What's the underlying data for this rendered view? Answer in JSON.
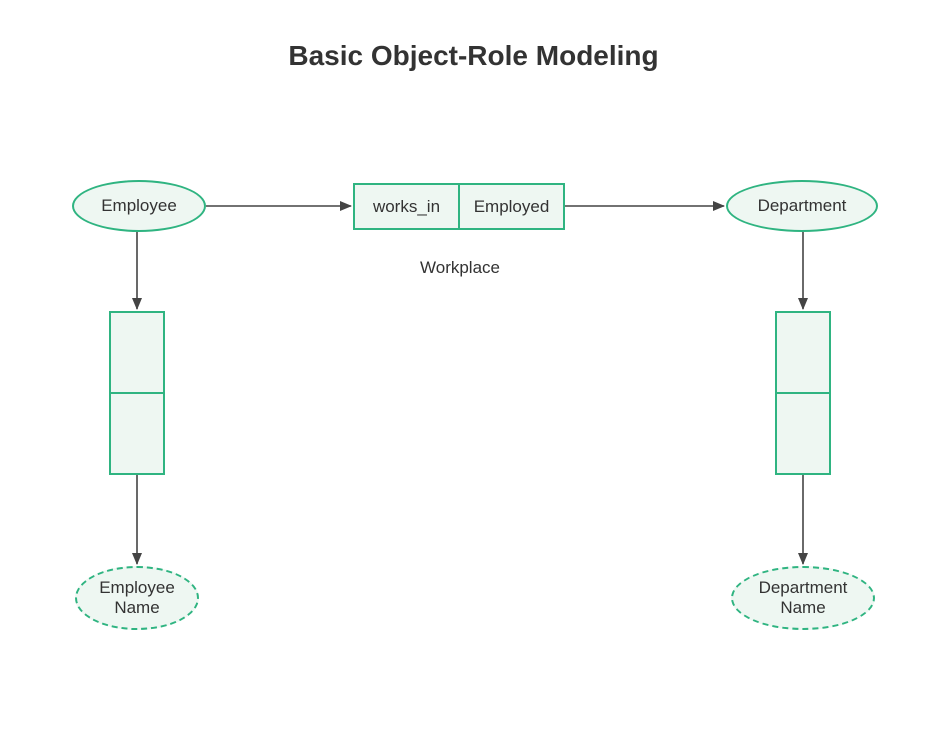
{
  "title": "Basic Object-Role Modeling",
  "entities": {
    "employee": {
      "label": "Employee"
    },
    "department": {
      "label": "Department"
    }
  },
  "values": {
    "employee_name": {
      "line1": "Employee",
      "line2": "Name"
    },
    "department_name": {
      "line1": "Department",
      "line2": "Name"
    }
  },
  "relation": {
    "cell1": "works_in",
    "cell2": "Employed",
    "label": "Workplace"
  },
  "colors": {
    "border": "#2fb481",
    "fill": "#eef7f2",
    "arrow": "#444444"
  }
}
